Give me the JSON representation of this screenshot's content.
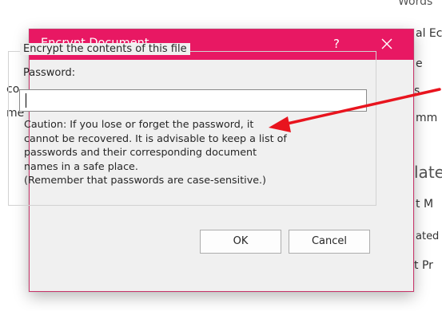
{
  "background": {
    "fragments": [
      "Words",
      "al Ec",
      "e",
      "s",
      "mm",
      "late",
      "t M",
      "ated",
      "t Pr"
    ],
    "left_fragments": [
      "co",
      "me"
    ]
  },
  "dialog": {
    "title": "Encrypt Document",
    "help_label": "?",
    "group_label": "Encrypt the contents of this file",
    "password_label": "Password:",
    "password_value": "",
    "caution_lines": [
      "Caution: If you lose or forget the password, it",
      "cannot be recovered. It is advisable to keep a list of",
      "passwords and their corresponding document",
      "names in a safe place.",
      "(Remember that passwords are case-sensitive.)"
    ],
    "ok_label": "OK",
    "cancel_label": "Cancel"
  },
  "colors": {
    "titlebar": "#e81863",
    "annotation_arrow": "#e8141e"
  },
  "icons": {
    "close": "close-icon",
    "annotation": "annotation-arrow"
  }
}
